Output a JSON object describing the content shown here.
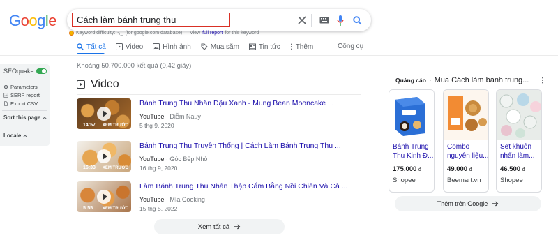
{
  "logo": {
    "letters": [
      "G",
      "o",
      "o",
      "g",
      "l",
      "e"
    ],
    "colors": [
      "#4285f4",
      "#ea4335",
      "#fbbc05",
      "#4285f4",
      "#34a853",
      "#ea4335"
    ]
  },
  "search": {
    "query": "Cách làm bánh trung thu"
  },
  "keyword_difficulty": {
    "label": "Keyword difficulty:",
    "value": "-,_",
    "note": "(for google.com database) — View",
    "link": "full report",
    "suffix": "for this keyword"
  },
  "tabs": [
    {
      "label": "Tất cả",
      "icon": "search-icon",
      "active": true
    },
    {
      "label": "Video",
      "icon": "video-icon"
    },
    {
      "label": "Hình ảnh",
      "icon": "image-icon"
    },
    {
      "label": "Mua sắm",
      "icon": "shopping-tag-icon"
    },
    {
      "label": "Tin tức",
      "icon": "news-icon"
    },
    {
      "label": "Thêm",
      "icon": "more-vert-icon"
    }
  ],
  "tools_label": "Công cụ",
  "seoquake": {
    "title": "SEOquake",
    "items": [
      "Parameters",
      "SERP report",
      "Export CSV"
    ],
    "sort_label": "Sort this page",
    "locale_label": "Locale"
  },
  "stats": "Khoảng 50.700.000 kết quả (0,42 giây)",
  "video_section": {
    "heading": "Video",
    "videos": [
      {
        "title": "Bánh Trung Thu Nhân Đậu Xanh - Mung Bean Mooncake ...",
        "source": "YouTube",
        "channel": "Diễm Nauy",
        "date": "5 thg 9, 2020",
        "duration": "14:57",
        "preview": "XEM TRƯỚC"
      },
      {
        "title": "Bánh Trung Thu Truyền Thống | Cách Làm Bánh Trung Thu ...",
        "source": "YouTube",
        "channel": "Góc Bếp Nhỏ",
        "date": "16 thg 9, 2020",
        "duration": "16:33",
        "preview": "XEM TRƯỚC"
      },
      {
        "title": "Làm Bánh Trung Thu Nhân Thập Cẩm Bằng Nồi Chiên Và Cả ...",
        "source": "YouTube",
        "channel": "Mía Cooking",
        "date": "15 thg 5, 2022",
        "duration": "5:55",
        "preview": "XEM TRƯỚC"
      }
    ],
    "see_all": "Xem tất cả"
  },
  "ads": {
    "sponsored": "Quảng cáo",
    "title": "Mua Cách làm bánh trung...",
    "cards": [
      {
        "title": "Bánh Trung Thu Kinh Đ...",
        "price": "175.000",
        "currency": "đ",
        "store": "Shopee"
      },
      {
        "title": "Combo nguyên liệu...",
        "price": "49.000",
        "currency": "đ",
        "store": "Beemart.vn"
      },
      {
        "title": "Set khuôn nhấn làm...",
        "price": "46.500",
        "currency": "đ",
        "store": "Shopee"
      }
    ],
    "more": "Thêm trên Google"
  },
  "colors": {
    "link": "#1a0dab",
    "accent": "#1a73e8",
    "toggle_on": "#34a853",
    "highlight_border": "#d93025"
  }
}
